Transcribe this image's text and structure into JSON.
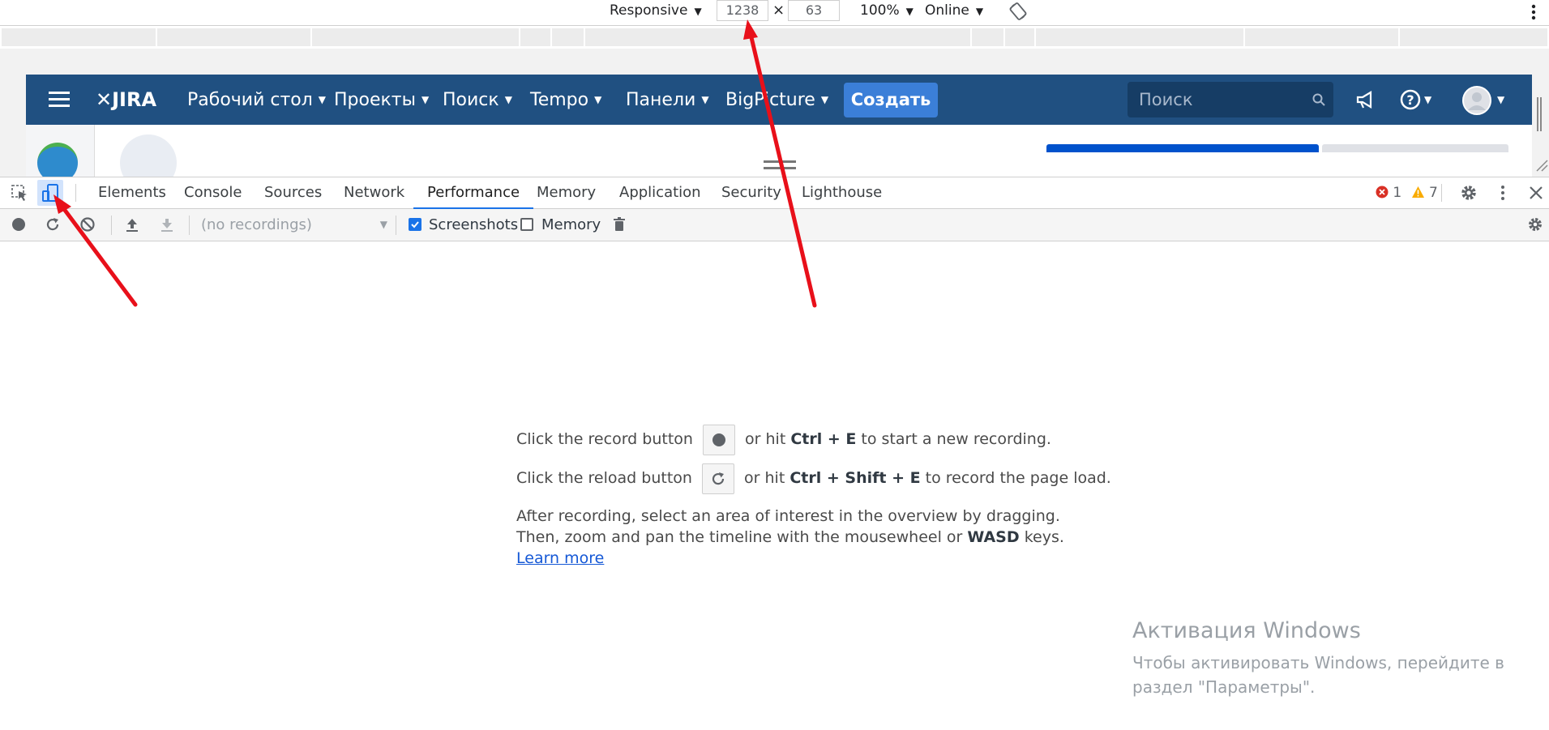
{
  "device_toolbar": {
    "device_mode": "Responsive",
    "width_value": "1238",
    "times_symbol": "×",
    "height_value": "63",
    "zoom": "100%",
    "throttling": "Online"
  },
  "jira": {
    "logo": "JIRA",
    "nav": [
      {
        "label": "Рабочий стол"
      },
      {
        "label": "Проекты"
      },
      {
        "label": "Поиск"
      },
      {
        "label": "Tempo"
      },
      {
        "label": "Панели"
      },
      {
        "label": "BigPicture"
      }
    ],
    "create_label": "Создать",
    "search_placeholder": "Поиск"
  },
  "devtools": {
    "tabs": [
      "Elements",
      "Console",
      "Sources",
      "Network",
      "Performance",
      "Memory",
      "Application",
      "Security",
      "Lighthouse"
    ],
    "active_tab": "Performance",
    "errors_count": "1",
    "warnings_count": "7",
    "error_color": "#d93025",
    "warning_color": "#f9ab00",
    "accent_color": "#1a73e8"
  },
  "performance": {
    "recordings_select": "(no recordings)",
    "screenshots_label": "Screenshots",
    "screenshots_checked": true,
    "memory_label": "Memory",
    "memory_checked": false,
    "landing": {
      "record_prefix": "Click the record button",
      "record_middle": "or hit",
      "record_shortcut": "Ctrl + E",
      "record_suffix": "to start a new recording.",
      "reload_prefix": "Click the reload button",
      "reload_middle": "or hit",
      "reload_shortcut": "Ctrl + Shift + E",
      "reload_suffix": "to record the page load.",
      "after_line1": "After recording, select an area of interest in the overview by dragging.",
      "after_line2_prefix": "Then, zoom and pan the timeline with the mousewheel or",
      "after_line2_keys": "WASD",
      "after_line2_suffix": "keys.",
      "learn_more": "Learn more"
    }
  },
  "watermark": {
    "title": "Активация Windows",
    "text": "Чтобы активировать Windows, перейдите в раздел \"Параметры\"."
  },
  "annotation_color": "#e8101a"
}
